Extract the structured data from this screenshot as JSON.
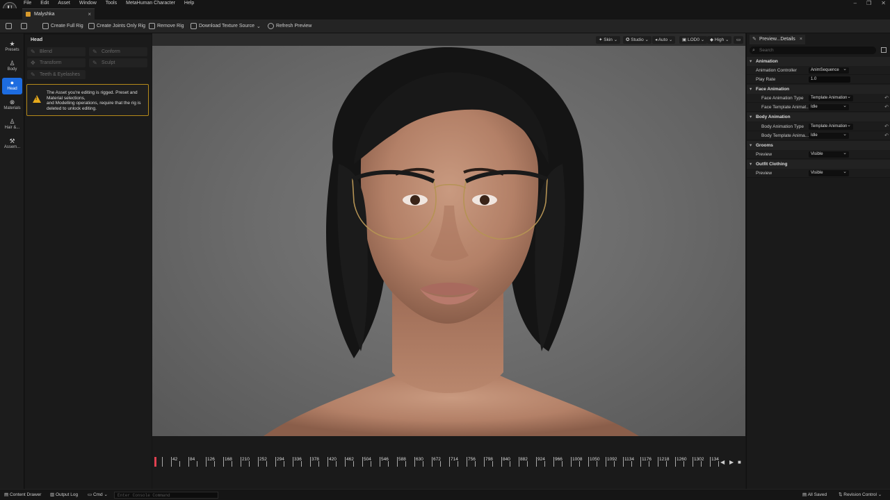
{
  "menubar": {
    "items": [
      "File",
      "Edit",
      "Asset",
      "Window",
      "Tools",
      "MetaHuman Character",
      "Help"
    ],
    "logo": "U"
  },
  "document_tab": {
    "title": "Malyshka",
    "close": "×"
  },
  "toolbar": {
    "create_full_rig": "Create Full Rig",
    "create_joints_rig": "Create Joints Only Rig",
    "remove_rig": "Remove Rig",
    "download_texture": "Download Texture Source",
    "refresh_preview": "Refresh Preview"
  },
  "left_nav": [
    {
      "label": "Presets",
      "icon": "star-icon",
      "glyph": "★"
    },
    {
      "label": "Body",
      "icon": "body-icon",
      "glyph": "♙"
    },
    {
      "label": "Head",
      "icon": "head-icon",
      "glyph": "●",
      "active": true
    },
    {
      "label": "Materials",
      "icon": "materials-icon",
      "glyph": "⊗"
    },
    {
      "label": "Hair &...",
      "icon": "hair-icon",
      "glyph": "♙"
    },
    {
      "label": "Assem...",
      "icon": "hammer-icon",
      "glyph": "⚒"
    }
  ],
  "head_panel": {
    "title": "Head",
    "buttons": {
      "blend": "Blend",
      "conform": "Conform",
      "transform": "Transform",
      "sculpt": "Sculpt",
      "teeth": "Teeth & Eyelashes"
    },
    "warning": "The Asset you're editing is rigged. Preset and Material selections,\nand Modelling operations, require that the rig is deleted to unlock editing."
  },
  "viewport_toolbar": {
    "skin": "Skin",
    "studio": "Studio",
    "auto": "Auto",
    "lod": "LOD0",
    "quality": "High"
  },
  "timeline": {
    "ticks": [
      "42",
      "84",
      "126",
      "168",
      "210",
      "252",
      "294",
      "336",
      "378",
      "420",
      "462",
      "504",
      "546",
      "588",
      "630",
      "672",
      "714",
      "756",
      "798",
      "840",
      "882",
      "924",
      "966",
      "1008",
      "1050",
      "1092",
      "1134",
      "1176",
      "1218",
      "1260",
      "1302",
      "134"
    ]
  },
  "details": {
    "tab_title": "Preview...Details",
    "search_placeholder": "Search",
    "sections": {
      "animation": "Animation",
      "face_animation": "Face Animation",
      "body_animation": "Body Animation",
      "grooms": "Grooms",
      "outfit": "Outfit Clothing"
    },
    "rows": {
      "anim_controller_label": "Animation Controller",
      "anim_controller_value": "AnimSequence",
      "play_rate_label": "Play Rate",
      "play_rate_value": "1.0",
      "face_anim_type_label": "Face Animation Type",
      "face_anim_type_value": "Template Animation",
      "face_template_label": "Face Template Animat...",
      "face_template_value": "Idle",
      "body_anim_type_label": "Body Animation Type",
      "body_anim_type_value": "Template Animation",
      "body_template_label": "Body Template Anima...",
      "body_template_value": "Idle",
      "grooms_preview_label": "Preview",
      "grooms_preview_value": "Visible",
      "outfit_preview_label": "Preview",
      "outfit_preview_value": "Visible"
    }
  },
  "statusbar": {
    "content_drawer": "Content Drawer",
    "output_log": "Output Log",
    "cmd": "Cmd",
    "console_placeholder": "Enter Console Command",
    "all_saved": "All Saved",
    "revision_control": "Revision Control"
  },
  "colors": {
    "accent": "#1d6ce0",
    "warning": "#e6a91b",
    "playhead": "#e04050"
  }
}
